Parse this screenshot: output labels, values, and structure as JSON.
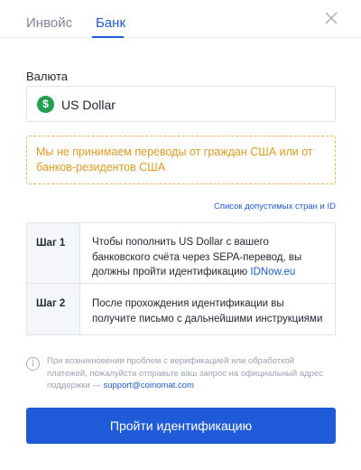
{
  "tabs": [
    {
      "label": "Инвойс",
      "active": false
    },
    {
      "label": "Банк",
      "active": true
    }
  ],
  "icons": {
    "close": "close-icon",
    "currency": "dollar-coin-icon",
    "info": "info-icon"
  },
  "colors": {
    "accent": "#1f5bd8",
    "warning": "#e39b1f",
    "coin": "#22a052"
  },
  "currency": {
    "label": "Валюта",
    "symbol": "$",
    "value": "US Dollar"
  },
  "warning": {
    "text": "Мы не принимаем переводы от граждан США или от банков-резидентов США"
  },
  "countries_link": "Список допустимых стран и ID",
  "steps": [
    {
      "label": "Шаг 1",
      "text": "Чтобы пополнить US Dollar с вашего банковского счёта через SEPA-перевод, вы должны пройти идентификацию ",
      "link": "IDNow.eu"
    },
    {
      "label": "Шаг 2",
      "text": "После прохождения идентификации вы получите письмо с дальнейшими инструкциями"
    }
  ],
  "info": {
    "text": "При возникновении проблем с верификацией или обработкой платежей, пожалуйста отправьте ваш запрос на официальный адрес поддержки — ",
    "email": "support@coinomat.com"
  },
  "submit_label": "Пройти идентификацию"
}
